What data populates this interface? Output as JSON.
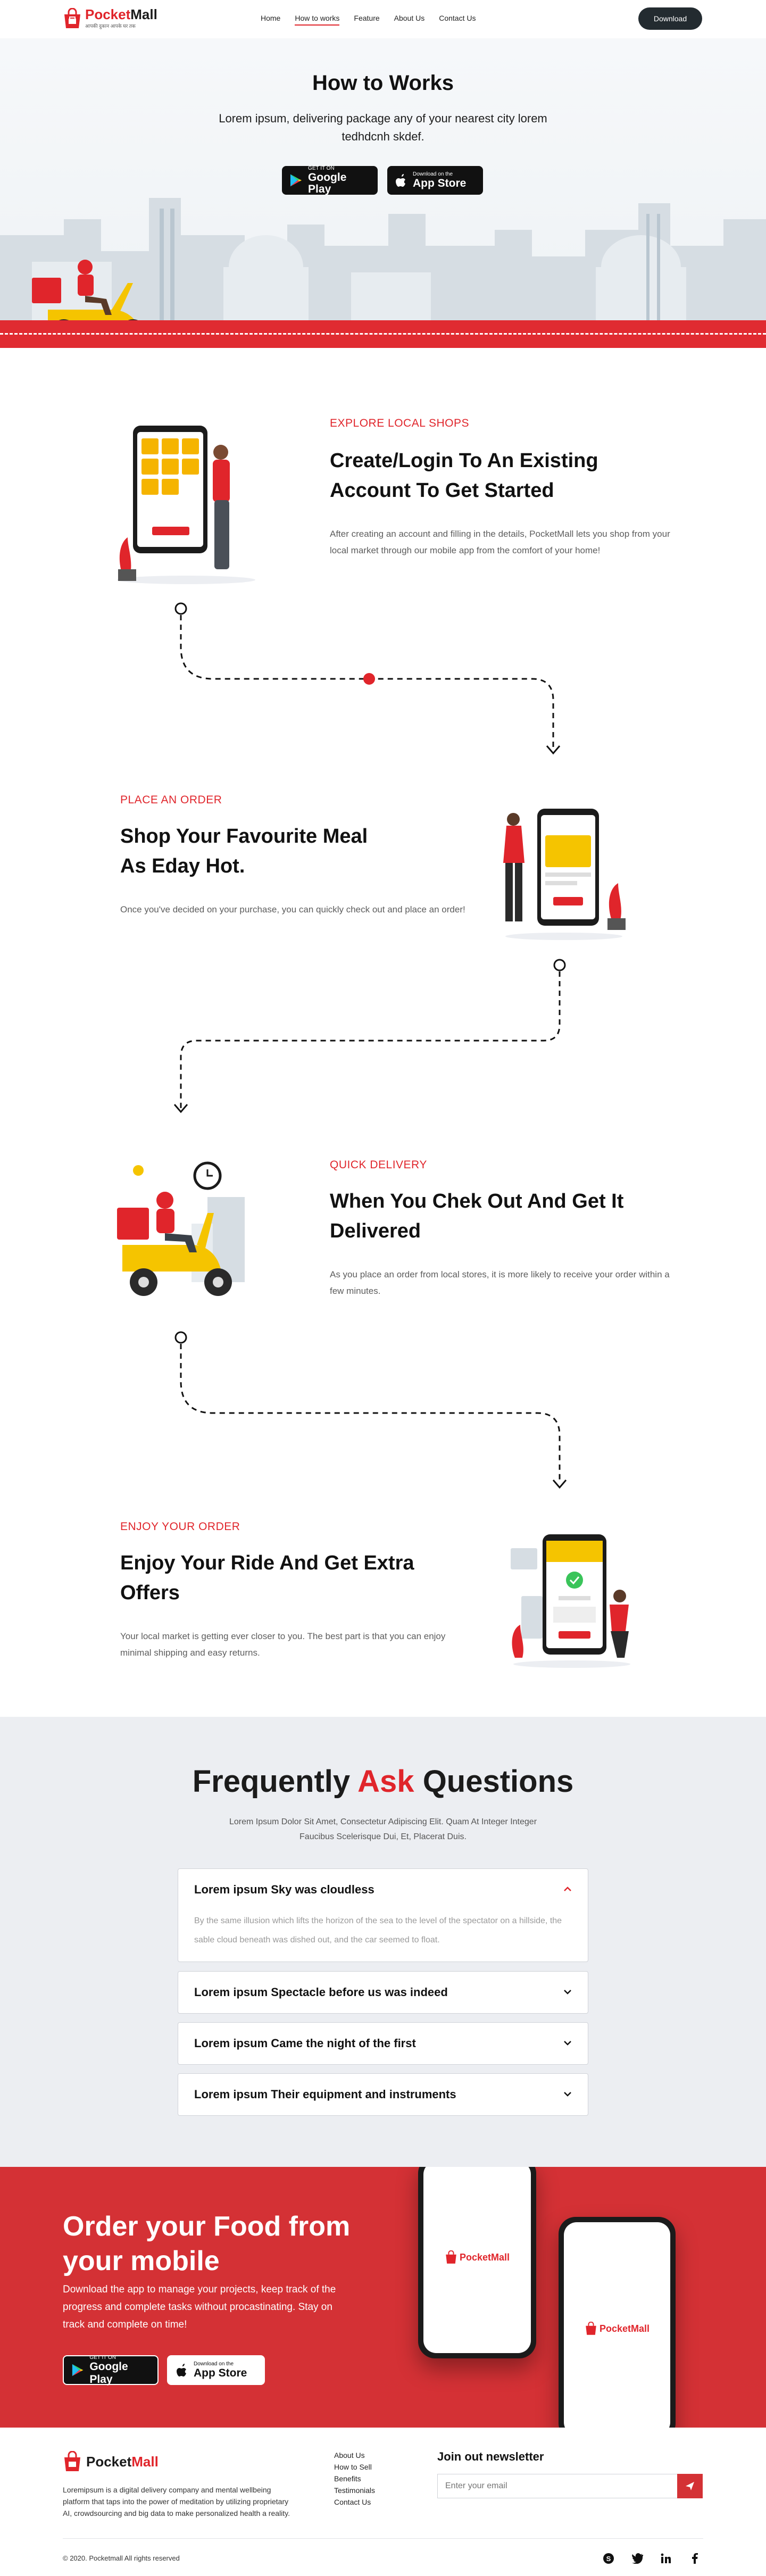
{
  "brand": {
    "name_a": "Pocket",
    "name_b": "Mall",
    "tagline": "आपकी दुकान आपके घर तक",
    "red": "#e0252b",
    "dark": "#232b30"
  },
  "nav": {
    "items": [
      {
        "label": "Home"
      },
      {
        "label": "How to works",
        "active": true
      },
      {
        "label": "Feature"
      },
      {
        "label": "About Us"
      },
      {
        "label": "Contact Us"
      }
    ],
    "download": "Download"
  },
  "hero": {
    "title": "How to Works",
    "subtitle": "Lorem ipsum, delivering package any of your nearest city lorem tedhdcnh skdef.",
    "google_small": "GET IT ON",
    "google_big": "Google Play",
    "apple_small": "Download on the",
    "apple_big": "App Store"
  },
  "steps": [
    {
      "eyebrow": "EXPLORE LOCAL SHOPS",
      "title": "Create/Login To An Existing Account To Get Started",
      "text": "After creating an account and filling in the details, PocketMall lets you shop from your local market through our mobile app from the comfort of your home!",
      "illustration": "phone-shop-illustration"
    },
    {
      "eyebrow": "PLACE AN ORDER",
      "title": "Shop Your Favourite Meal As Eday Hot.",
      "text": "Once you've decided on your purchase, you can quickly check out and place an order!",
      "illustration": "order-phone-illustration"
    },
    {
      "eyebrow": "QUICK DELIVERY",
      "title": "When You Chek Out And Get It Delivered",
      "text": "As you place an order from local stores, it is more likely to receive your order within a few minutes.",
      "illustration": "scooter-delivery-illustration"
    },
    {
      "eyebrow": "ENJOY YOUR ORDER",
      "title": "Enjoy Your Ride And Get Extra Offers",
      "text": "Your local market is getting ever closer to you. The best part is that you can enjoy minimal shipping and easy returns.",
      "illustration": "thank-you-phone-illustration"
    }
  ],
  "faq": {
    "title_a": "Frequently",
    "title_b": "Ask",
    "title_c": "Questions",
    "subtitle": "Lorem Ipsum Dolor Sit Amet, Consectetur Adipiscing Elit. Quam At Integer Integer Faucibus Scelerisque Dui, Et, Placerat Duis.",
    "items": [
      {
        "q": "Lorem ipsum Sky was cloudless",
        "a": "By the same illusion which lifts the horizon of the sea to the level of the spectator on a hillside, the sable cloud beneath was dished out, and the car seemed to float.",
        "open": true
      },
      {
        "q": "Lorem ipsum Spectacle before us was indeed",
        "open": false
      },
      {
        "q": "Lorem ipsum Came the night of the first",
        "open": false
      },
      {
        "q": "Lorem ipsum Their equipment and instruments",
        "open": false
      }
    ]
  },
  "app": {
    "title": "Order your Food from your mobile",
    "text": "Download the app to manage your projects, keep track of the progress and complete tasks without procastinating. Stay on track and complete on time!",
    "phone_brand": "PocketMall",
    "bg": "#d43135"
  },
  "footer": {
    "brand_a": "Pocket",
    "brand_b": "Mall",
    "desc": "Loremipsum is a digital delivery company and mental wellbeing platform that taps into the power of meditation by utilizing proprietary AI, crowdsourcing and big data to make personalized health a reality.",
    "links": [
      "About Us",
      "How to Sell",
      "Benefits",
      "Testimonials",
      "Contact Us"
    ],
    "newsletter": "Join out newsletter",
    "email_placeholder": "Enter your email",
    "copyright": "© 2020. Pocketmall All rights reserved",
    "socials": [
      "skype-icon",
      "twitter-icon",
      "linkedin-icon",
      "facebook-icon"
    ]
  }
}
